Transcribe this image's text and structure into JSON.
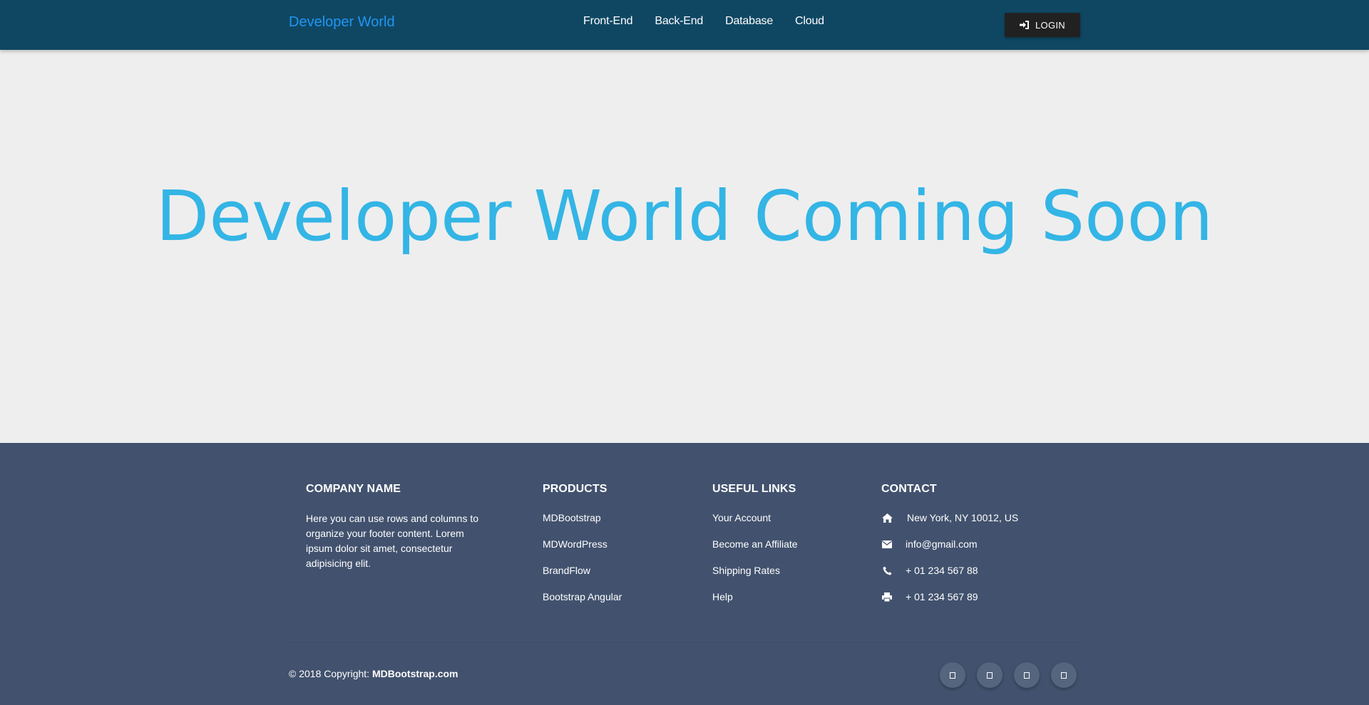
{
  "navbar": {
    "brand": "Developer World",
    "links": [
      "Front-End",
      "Back-End",
      "Database",
      "Cloud"
    ],
    "login_label": "LOGIN"
  },
  "hero": {
    "title": "Developer World Coming Soon"
  },
  "footer": {
    "company": {
      "heading": "COMPANY NAME",
      "text": "Here you can use rows and columns to organize your footer content. Lorem ipsum dolor sit amet, consectetur adipisicing elit."
    },
    "products": {
      "heading": "PRODUCTS",
      "items": [
        "MDBootstrap",
        "MDWordPress",
        "BrandFlow",
        "Bootstrap Angular"
      ]
    },
    "useful_links": {
      "heading": "USEFUL LINKS",
      "items": [
        "Your Account",
        "Become an Affiliate",
        "Shipping Rates",
        "Help"
      ]
    },
    "contact": {
      "heading": "CONTACT",
      "items": [
        {
          "icon": "home-icon",
          "text": "New York, NY 10012, US"
        },
        {
          "icon": "envelope-icon",
          "text": "info@gmail.com"
        },
        {
          "icon": "phone-icon",
          "text": "+ 01 234 567 88"
        },
        {
          "icon": "print-icon",
          "text": "+ 01 234 567 89"
        }
      ]
    },
    "copyright_prefix": "© 2018 Copyright: ",
    "copyright_link": "MDBootstrap.com",
    "social_icons": [
      "social-icon-1",
      "social-icon-2",
      "social-icon-3",
      "social-icon-4"
    ]
  },
  "colors": {
    "navbar_bg": "#0f4763",
    "brand": "#2196f3",
    "hero_bg": "#eeeeee",
    "hero_title": "#33b5e5",
    "footer_bg": "#42526e",
    "login_bg": "#212121"
  }
}
